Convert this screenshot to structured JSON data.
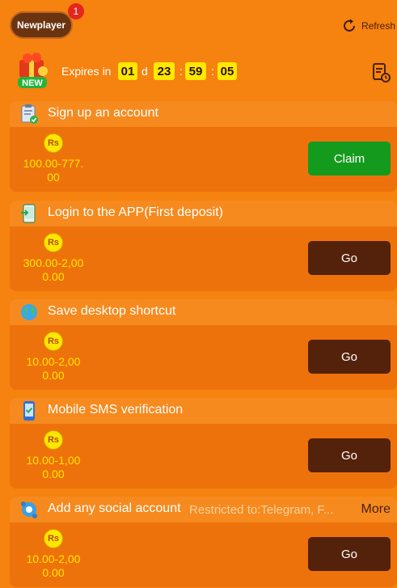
{
  "header": {
    "tab_label": "Newplayer",
    "badge_count": "1",
    "refresh_label": "Refresh"
  },
  "countdown": {
    "new_tag": "NEW",
    "expires_label": "Expires in",
    "days": "01",
    "days_unit": "d",
    "hours": "23",
    "minutes": "59",
    "seconds": "05",
    "separator": ":"
  },
  "tasks": [
    {
      "title": "Sign up an account",
      "subtitle": "",
      "more_label": "",
      "currency": "Rs",
      "amount_line1": "100.00-777.",
      "amount_line2": "00",
      "button_label": "Claim",
      "button_type": "claim",
      "icon": "clipboard-check-icon"
    },
    {
      "title": "Login to the APP(First deposit)",
      "subtitle": "",
      "more_label": "",
      "currency": "Rs",
      "amount_line1": "300.00-2,00",
      "amount_line2": "0.00",
      "button_label": "Go",
      "button_type": "go",
      "icon": "phone-login-icon"
    },
    {
      "title": "Save desktop shortcut",
      "subtitle": "",
      "more_label": "",
      "currency": "Rs",
      "amount_line1": "10.00-2,00",
      "amount_line2": "0.00",
      "button_label": "Go",
      "button_type": "go",
      "icon": "globe-icon"
    },
    {
      "title": "Mobile SMS verification",
      "subtitle": "",
      "more_label": "",
      "currency": "Rs",
      "amount_line1": "10.00-1,00",
      "amount_line2": "0.00",
      "button_label": "Go",
      "button_type": "go",
      "icon": "mobile-check-icon"
    },
    {
      "title": "Add any social account",
      "subtitle": "Restricted to:Telegram, F...",
      "more_label": "More",
      "currency": "Rs",
      "amount_line1": "10.00-2,00",
      "amount_line2": "0.00",
      "button_label": "Go",
      "button_type": "go",
      "icon": "social-gear-icon"
    }
  ],
  "colors": {
    "background": "#f6820f",
    "claim_button": "#149b1d",
    "go_button": "#54220a",
    "amount_text": "#ffe600",
    "timer_box": "#ffe800"
  }
}
